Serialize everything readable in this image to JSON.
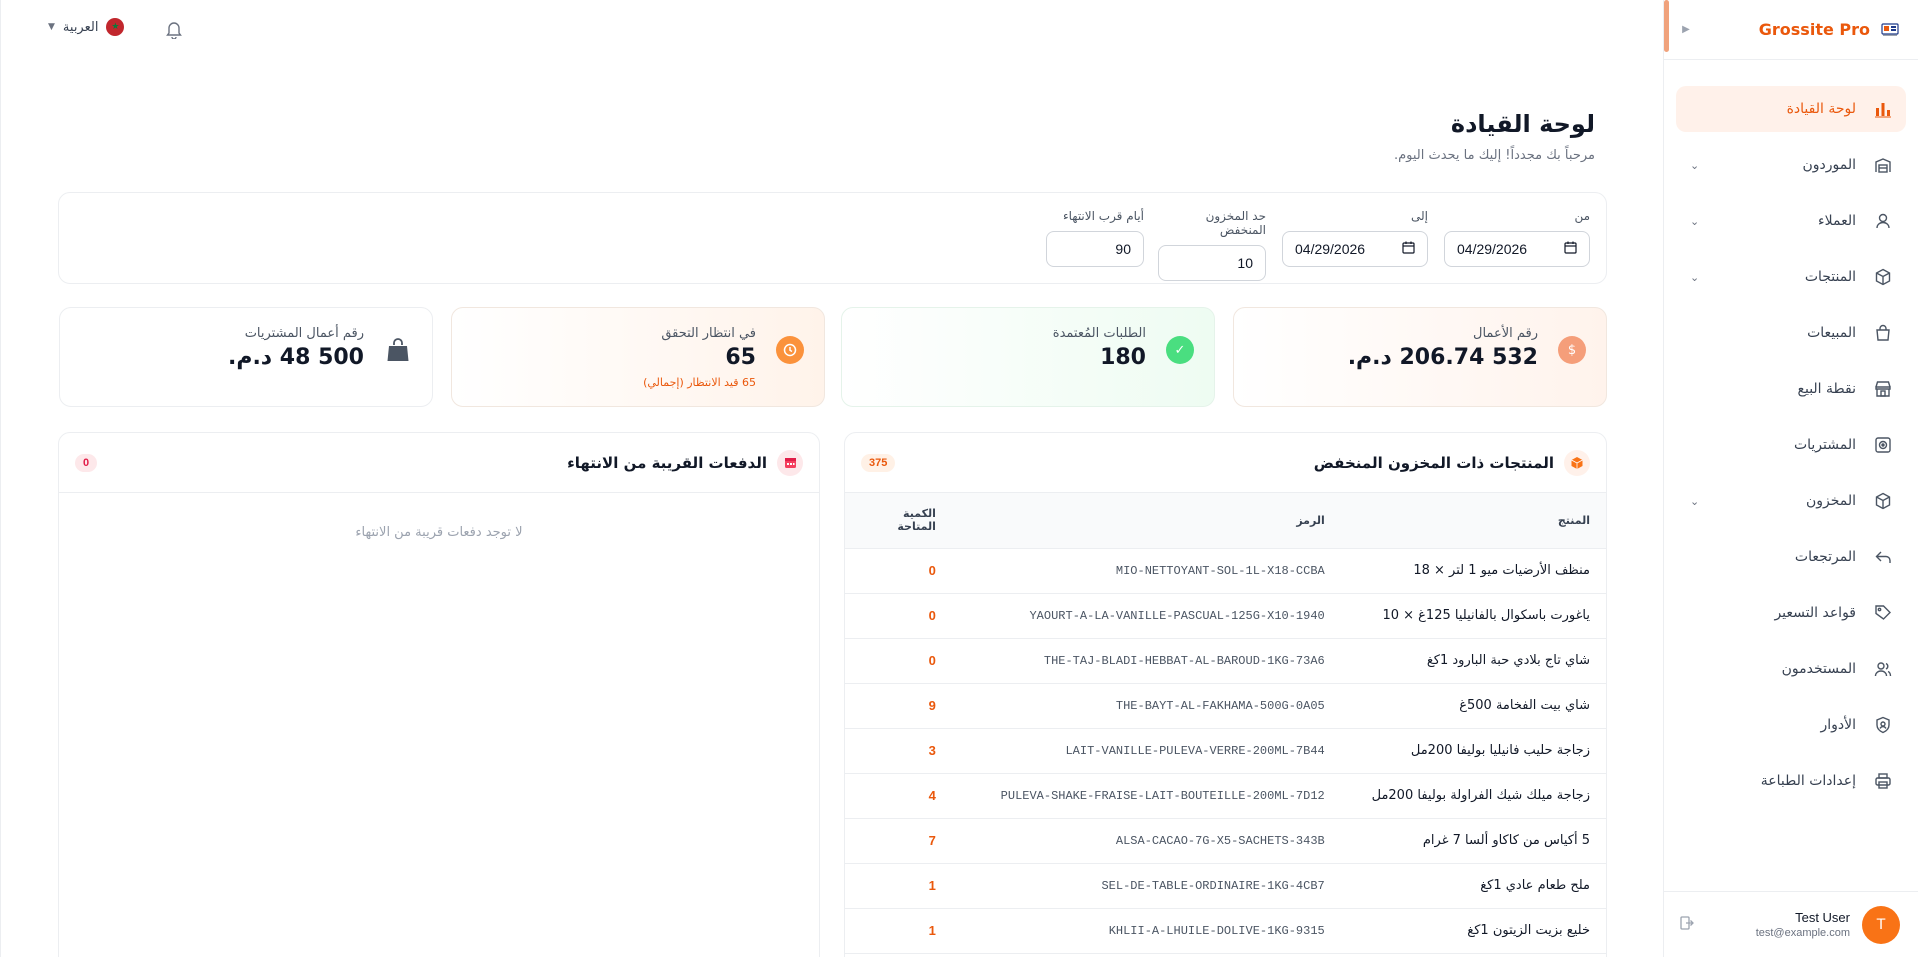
{
  "brand": {
    "name": "Grossite Pro"
  },
  "sidebar": {
    "items": [
      {
        "label": "لوحة القيادة",
        "icon": "bar-chart-icon",
        "active": true,
        "expandable": false
      },
      {
        "label": "الموردون",
        "icon": "warehouse-icon",
        "active": false,
        "expandable": true
      },
      {
        "label": "العملاء",
        "icon": "user-icon",
        "active": false,
        "expandable": true
      },
      {
        "label": "المنتجات",
        "icon": "box-icon",
        "active": false,
        "expandable": true
      },
      {
        "label": "المبيعات",
        "icon": "shopping-bag-icon",
        "active": false,
        "expandable": false
      },
      {
        "label": "نقطة البيع",
        "icon": "store-icon",
        "active": false,
        "expandable": false
      },
      {
        "label": "المشتريات",
        "icon": "purchase-icon",
        "active": false,
        "expandable": false
      },
      {
        "label": "المخزون",
        "icon": "package-icon",
        "active": false,
        "expandable": true
      },
      {
        "label": "المرتجعات",
        "icon": "return-arrow-icon",
        "active": false,
        "expandable": false
      },
      {
        "label": "قواعد التسعير",
        "icon": "tag-icon",
        "active": false,
        "expandable": false
      },
      {
        "label": "المستخدمون",
        "icon": "users-icon",
        "active": false,
        "expandable": false
      },
      {
        "label": "الأدوار",
        "icon": "shield-icon",
        "active": false,
        "expandable": false
      },
      {
        "label": "إعدادات الطباعة",
        "icon": "printer-icon",
        "active": false,
        "expandable": false
      }
    ]
  },
  "user": {
    "initial": "T",
    "name": "Test User",
    "email": "test@example.com"
  },
  "topbar": {
    "language": "العربية"
  },
  "page": {
    "title": "لوحة القيادة",
    "subtitle": "مرحباً بك مجدداً! إليك ما يحدث اليوم."
  },
  "filters": {
    "from_label": "من",
    "from_value": "04/29/2026",
    "to_label": "إلى",
    "to_value": "04/29/2026",
    "low_stock_label": "حد المخزون المنخفض",
    "low_stock_value": "10",
    "expiry_days_label": "أيام قرب الانتهاء",
    "expiry_days_value": "90"
  },
  "cards": {
    "revenue": {
      "label": "رقم الأعمال",
      "value": "532 206.74 د.م.",
      "icon": "dollar-icon",
      "color": "#f59e7a"
    },
    "approved": {
      "label": "الطلبات المُعتمدة",
      "value": "180",
      "icon": "check-icon",
      "color": "#4ade80"
    },
    "pending": {
      "label": "في انتظار التحقق",
      "value": "65",
      "note": "65 قيد الانتظار (إجمالي)",
      "icon": "clock-icon",
      "color": "#fb923c"
    },
    "purchases": {
      "label": "رقم أعمال المشتريات",
      "value": "500 48 د.م.",
      "icon": "bag-icon",
      "color": "#4b5563"
    }
  },
  "low_stock": {
    "title": "المنتجات ذات المخزون المنخفض",
    "count": "375",
    "headers": {
      "product": "المنتج",
      "code": "الرمز",
      "qty": "الكمية المتاحة"
    },
    "rows": [
      {
        "product": "منظف الأرضيات ميو 1 لتر × 18",
        "code": "MIO-NETTOYANT-SOL-1L-X18-CCBA",
        "qty": "0"
      },
      {
        "product": "ياغورت باسكوال بالفانيليا 125غ × 10",
        "code": "YAOURT-A-LA-VANILLE-PASCUAL-125G-X10-1940",
        "qty": "0"
      },
      {
        "product": "شاي تاج بلادي حبة البارود 1كغ",
        "code": "THE-TAJ-BLADI-HEBBAT-AL-BAROUD-1KG-73A6",
        "qty": "0"
      },
      {
        "product": "شاي بيت الفخامة 500غ",
        "code": "THE-BAYT-AL-FAKHAMA-500G-0A05",
        "qty": "9"
      },
      {
        "product": "زجاجة حليب فانيليا بوليفا 200مل",
        "code": "LAIT-VANILLE-PULEVA-VERRE-200ML-7B44",
        "qty": "3"
      },
      {
        "product": "زجاجة ميلك شيك الفراولة بوليفا 200مل",
        "code": "PULEVA-SHAKE-FRAISE-LAIT-BOUTEILLE-200ML-7D12",
        "qty": "4"
      },
      {
        "product": "5 أكياس من كاكاو ألسا 7 غرام",
        "code": "ALSA-CACAO-7G-X5-SACHETS-343B",
        "qty": "7"
      },
      {
        "product": "ملح طعام عادي 1كغ",
        "code": "SEL-DE-TABLE-ORDINAIRE-1KG-4CB7",
        "qty": "1"
      },
      {
        "product": "خليع بزيت الزيتون 1كغ",
        "code": "KHLII-A-LHUILE-DOLIVE-1KG-9315",
        "qty": "1"
      }
    ]
  },
  "expiring": {
    "title": "الدفعات القريبة من الانتهاء",
    "count": "0",
    "empty_text": "لا توجد دفعات قريبة من الانتهاء"
  }
}
